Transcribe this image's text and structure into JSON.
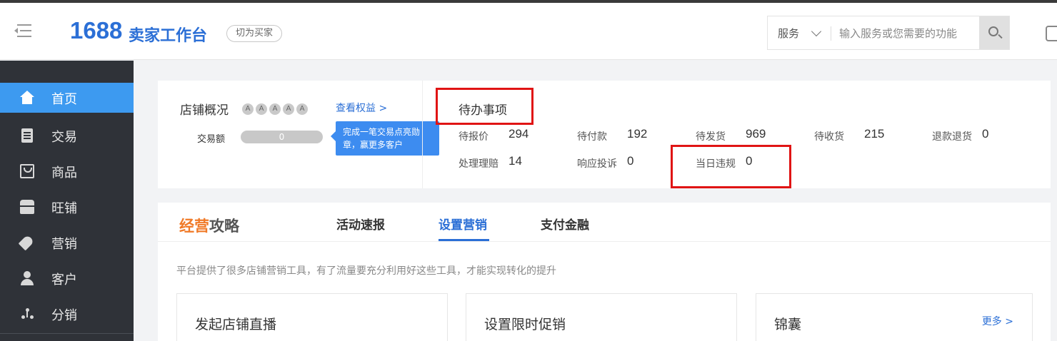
{
  "header": {
    "logo_number": "1688",
    "logo_text": "卖家工作台",
    "switch_label": "切为买家",
    "search": {
      "category": "服务",
      "placeholder": "输入服务或您需要的功能"
    }
  },
  "sidebar": {
    "items": [
      {
        "label": "首页",
        "icon": "home-icon",
        "active": true
      },
      {
        "label": "交易",
        "icon": "clipboard-icon",
        "active": false
      },
      {
        "label": "商品",
        "icon": "bag-icon",
        "active": false
      },
      {
        "label": "旺铺",
        "icon": "shop-icon",
        "active": false
      },
      {
        "label": "营销",
        "icon": "tag-icon",
        "active": false
      },
      {
        "label": "客户",
        "icon": "user-icon",
        "active": false
      },
      {
        "label": "分销",
        "icon": "share-icon",
        "active": false
      }
    ]
  },
  "overview": {
    "title": "店铺概况",
    "star_glyph": "A",
    "star_count": 5,
    "view_rights": "查看权益 >",
    "trade_label": "交易额",
    "trade_value": "0",
    "tip": "完成一笔交易点亮勋章，赢更多客户"
  },
  "todo": {
    "title": "待办事项",
    "items": [
      {
        "label": "待报价",
        "value": "294"
      },
      {
        "label": "待付款",
        "value": "192"
      },
      {
        "label": "待发货",
        "value": "969"
      },
      {
        "label": "待收货",
        "value": "215"
      },
      {
        "label": "退款退货",
        "value": "0"
      },
      {
        "label": "处理理赔",
        "value": "14"
      },
      {
        "label": "响应投诉",
        "value": "0"
      },
      {
        "label": "当日违规",
        "value": "0"
      }
    ]
  },
  "strategy": {
    "logo_part1": "经营",
    "logo_part2": "攻略",
    "tabs": [
      {
        "label": "活动速报",
        "active": false
      },
      {
        "label": "设置营销",
        "active": true
      },
      {
        "label": "支付金融",
        "active": false
      }
    ],
    "description": "平台提供了很多店铺营销工具，有了流量要充分利用好这些工具，才能实现转化的提升",
    "cards": [
      {
        "title": "发起店铺直播"
      },
      {
        "title": "设置限时促销"
      },
      {
        "title": "锦囊",
        "more": "更多 >"
      }
    ]
  },
  "colors": {
    "accent": "#2b6fd6",
    "sidebar_bg": "#2f3238",
    "sidebar_active": "#3d9af0",
    "highlight_box": "#e01414",
    "brand_orange": "#f07a28"
  }
}
